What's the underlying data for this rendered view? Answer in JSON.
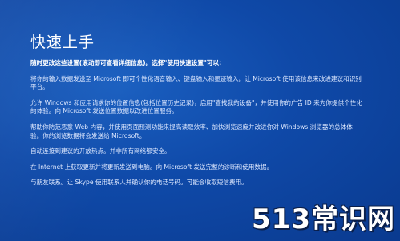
{
  "header": {
    "title": "快速上手"
  },
  "main": {
    "lead": "随时更改这些设置(滚动即可查看详细信息)。选择\"使用快速设置\"可以:",
    "paragraphs": [
      "将你的输入数据发送至 Microsoft 即可个性化语音输入、键盘输入和墨迹输入。让 Microsoft 使用该信息来改进建议和识别平台。",
      "允许 Windows 和应用请求你的位置信息(包括位置历史记录)，启用\"查找我的设备\"，并使用你的广告 ID 来为你提供个性化的体验。向 Microsoft 发送位置数据以改进位置服务。",
      "帮助你防范恶意 Web 内容，并使用页面预测功能来提高读取效率、加快浏览速度并改进你对 Windows 浏览器的总体体验。你的浏览数据将会发送给 Microsoft。",
      "自动连接到建议的开放热点。并非所有网络都安全。",
      "在 Internet 上获取更新并将更新发送到电脑。向 Microsoft 发送完整的诊断和使用数据。",
      "与朋友联系。让 Skype 使用联系人并确认你的电话号码。可能会收取短信费用。"
    ]
  },
  "watermark": {
    "text": "513常识网"
  }
}
